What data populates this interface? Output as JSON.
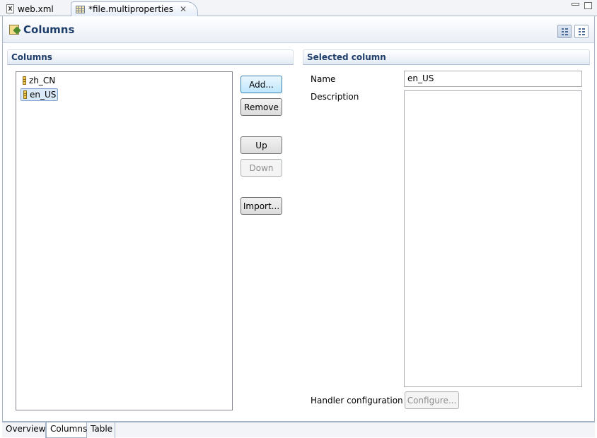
{
  "tabs": [
    {
      "label": "web.xml",
      "icon": "xml-file-icon",
      "active": false
    },
    {
      "label": "*file.multiproperties",
      "icon": "table-file-icon",
      "active": true
    }
  ],
  "form": {
    "title": "Columns",
    "title_icon": "columns-editor-icon"
  },
  "columns_section": {
    "title": "Columns",
    "items": [
      {
        "label": "zh_CN",
        "selected": false
      },
      {
        "label": "en_US",
        "selected": true
      }
    ],
    "buttons": {
      "add": "Add...",
      "remove": "Remove",
      "up": "Up",
      "down": "Down",
      "import": "Import..."
    }
  },
  "selected_section": {
    "title": "Selected column",
    "name_label": "Name",
    "name_value": "en_US",
    "description_label": "Description",
    "description_value": "",
    "handler_label": "Handler configuration",
    "configure_button": "Configure..."
  },
  "page_tabs": [
    {
      "label": "Overview",
      "active": false
    },
    {
      "label": "Columns",
      "active": true
    },
    {
      "label": "Table",
      "active": false
    }
  ],
  "colors": {
    "title": "#1f3e6a",
    "selection": "#dbe8f8",
    "border": "#a6b4c8"
  }
}
